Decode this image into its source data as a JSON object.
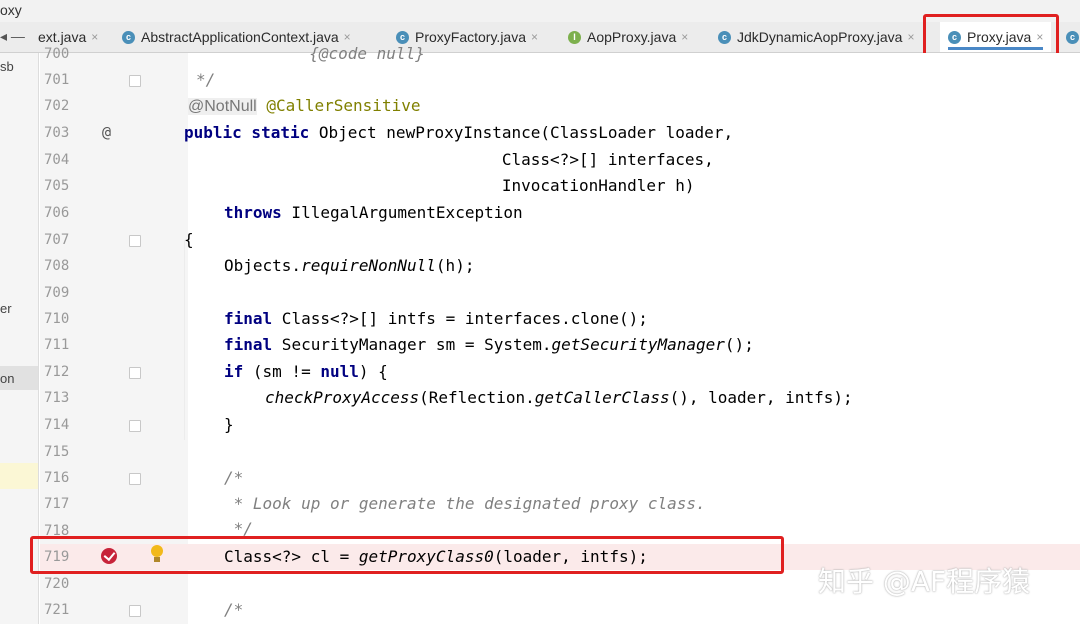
{
  "project_label": "oxy",
  "left_panel": {
    "items": [
      {
        "label": "sb"
      },
      {
        "label": "er"
      },
      {
        "label": "on"
      }
    ]
  },
  "tabs": [
    {
      "label": "ext.java",
      "icon": "class-icon",
      "active": false
    },
    {
      "label": "AbstractApplicationContext.java",
      "icon": "class-icon",
      "active": false
    },
    {
      "label": "ProxyFactory.java",
      "icon": "class-icon",
      "active": false
    },
    {
      "label": "AopProxy.java",
      "icon": "interface-icon",
      "active": false
    },
    {
      "label": "JdkDynamicAopProxy.java",
      "icon": "class-icon",
      "active": false
    },
    {
      "label": "Proxy.java",
      "icon": "class-icon",
      "active": true
    }
  ],
  "tab_close_symbol": "×",
  "code": {
    "lines": [
      {
        "n": "700",
        "text": "             {@code null}"
      },
      {
        "n": "701",
        "text": "*/"
      },
      {
        "n": "702",
        "ann1": "@NotNull",
        "ann2": "@CallerSensitive"
      },
      {
        "n": "703",
        "kw": "public static",
        "rest": " Object newProxyInstance(ClassLoader loader,"
      },
      {
        "n": "704",
        "text": "                                 Class<?>[] interfaces,"
      },
      {
        "n": "705",
        "text": "                                 InvocationHandler h)"
      },
      {
        "n": "706",
        "kw": "throws",
        "rest": " IllegalArgumentException"
      },
      {
        "n": "707",
        "text": "{"
      },
      {
        "n": "708",
        "pre": "Objects.",
        "it": "requireNonNull",
        "post": "(h);"
      },
      {
        "n": "709",
        "text": ""
      },
      {
        "n": "710",
        "kw": "final",
        "rest": " Class<?>[] intfs = interfaces.clone();"
      },
      {
        "n": "711",
        "kw": "final",
        "rest": " SecurityManager sm = System.",
        "it": "getSecurityManager",
        "post": "();"
      },
      {
        "n": "712",
        "kw": "if",
        "rest": " (sm != ",
        "kw2": "null",
        "post": ") {"
      },
      {
        "n": "713",
        "it": "checkProxyAccess",
        "rest": "(Reflection.",
        "it2": "getCallerClass",
        "post": "(), loader, intfs);"
      },
      {
        "n": "714",
        "text": "}"
      },
      {
        "n": "715",
        "text": ""
      },
      {
        "n": "716",
        "text": "/*"
      },
      {
        "n": "717",
        "text": " * Look up or generate the designated proxy class."
      },
      {
        "n": "718",
        "text": " */"
      },
      {
        "n": "719",
        "pre": "Class<?> cl = ",
        "it": "getProxyClass0",
        "post": "(loader, intfs);"
      },
      {
        "n": "720",
        "text": ""
      },
      {
        "n": "721",
        "text": "/*"
      }
    ]
  },
  "watermark": "知乎 @AF程序猿",
  "colors": {
    "keyword": "#000080",
    "comment": "#808080",
    "annotation": "#808000",
    "highlight_box": "#e02020"
  }
}
